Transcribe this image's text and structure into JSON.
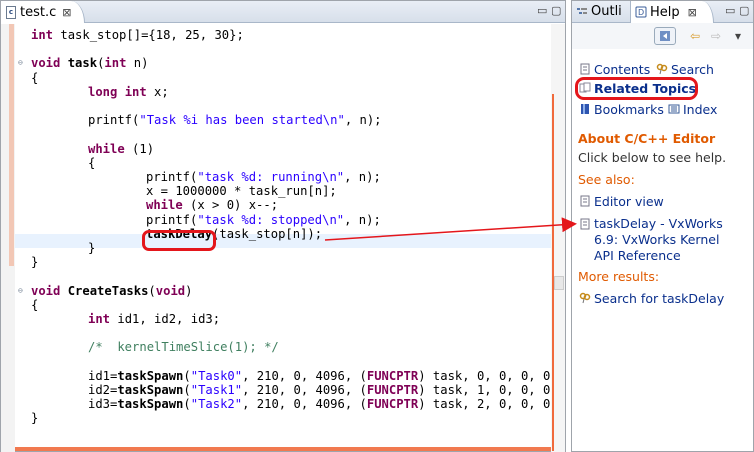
{
  "editor": {
    "tab_title": "test.c",
    "tab_close": "⊠",
    "minimize": "▭",
    "maximize": "▢",
    "lines": [
      [
        {
          "t": "int",
          "c": "kw"
        },
        {
          "t": " task_stop[]={18, 25, 30};"
        }
      ],
      [],
      [
        {
          "t": "void",
          "c": "kw"
        },
        {
          "t": " "
        },
        {
          "t": "task",
          "c": "fn"
        },
        {
          "t": "("
        },
        {
          "t": "int",
          "c": "kw"
        },
        {
          "t": " n)"
        }
      ],
      [
        {
          "t": "{"
        }
      ],
      [
        {
          "t": "long",
          "c": "kw"
        },
        {
          "t": " "
        },
        {
          "t": "int",
          "c": "kw"
        },
        {
          "t": " x;"
        }
      ],
      [],
      [
        {
          "t": "printf("
        },
        {
          "t": "\"Task %i has been started\\n\"",
          "c": "str"
        },
        {
          "t": ", n);"
        }
      ],
      [],
      [
        {
          "t": "while",
          "c": "kw"
        },
        {
          "t": " (1)"
        }
      ],
      [
        {
          "t": "{"
        }
      ],
      [
        {
          "t": "printf("
        },
        {
          "t": "\"task %d: running\\n\"",
          "c": "str"
        },
        {
          "t": ", n);"
        }
      ],
      [
        {
          "t": "x = 1000000 * task_run[n];"
        }
      ],
      [
        {
          "t": "while",
          "c": "kw"
        },
        {
          "t": " (x > 0) x--;"
        }
      ],
      [
        {
          "t": "printf("
        },
        {
          "t": "\"task %d: stopped\\n\"",
          "c": "str"
        },
        {
          "t": ", n);"
        }
      ],
      [
        {
          "t": "taskDelay",
          "c": "fn"
        },
        {
          "t": "(task_stop[n]);"
        }
      ],
      [
        {
          "t": "}"
        }
      ],
      [
        {
          "t": "}"
        }
      ],
      [],
      [
        {
          "t": "void",
          "c": "kw"
        },
        {
          "t": " "
        },
        {
          "t": "CreateTasks",
          "c": "fn"
        },
        {
          "t": "("
        },
        {
          "t": "void",
          "c": "kw"
        },
        {
          "t": ")"
        }
      ],
      [
        {
          "t": "{"
        }
      ],
      [
        {
          "t": "int",
          "c": "kw"
        },
        {
          "t": " id1, id2, id3;"
        }
      ],
      [],
      [
        {
          "t": "/*  kernelTimeSlice(1); */",
          "c": "cmt"
        }
      ],
      [],
      [
        {
          "t": "id1="
        },
        {
          "t": "taskSpawn",
          "c": "fn"
        },
        {
          "t": "("
        },
        {
          "t": "\"Task0\"",
          "c": "str"
        },
        {
          "t": ", 210, 0, 4096, ("
        },
        {
          "t": "FUNCPTR",
          "c": "kw"
        },
        {
          "t": ") task, 0, 0, 0, 0,"
        }
      ],
      [
        {
          "t": "id2="
        },
        {
          "t": "taskSpawn",
          "c": "fn"
        },
        {
          "t": "("
        },
        {
          "t": "\"Task1\"",
          "c": "str"
        },
        {
          "t": ", 210, 0, 4096, ("
        },
        {
          "t": "FUNCPTR",
          "c": "kw"
        },
        {
          "t": ") task, 1, 0, 0, 0,"
        }
      ],
      [
        {
          "t": "id3="
        },
        {
          "t": "taskSpawn",
          "c": "fn"
        },
        {
          "t": "("
        },
        {
          "t": "\"Task2\"",
          "c": "str"
        },
        {
          "t": ", 210, 0, 4096, ("
        },
        {
          "t": "FUNCPTR",
          "c": "kw"
        },
        {
          "t": ") task, 2, 0, 0, 0,"
        }
      ],
      [
        {
          "t": "}"
        }
      ]
    ]
  },
  "help": {
    "tab_outline": "Outli",
    "tab_help": "Help",
    "tab_close": "⊠",
    "minimize": "▭",
    "maximize": "▢",
    "toolbar": {
      "back": "⇦",
      "forward": "⇨",
      "menu": "▾"
    },
    "links": {
      "contents": "Contents",
      "search": "Search",
      "related_topics": "Related Topics",
      "bookmarks": "Bookmarks",
      "index": "Index"
    },
    "about_heading": "About C/C++ Editor",
    "about_text": "Click below to see help.",
    "see_also_heading": "See also:",
    "editor_view": "Editor view",
    "reference_line1": "taskDelay - VxWorks",
    "reference_line2": "6.9: VxWorks Kernel",
    "reference_line3": "API Reference",
    "more_results_heading": "More results:",
    "search_for": "Search for taskDelay"
  },
  "colors": {
    "keyword": "#7f0055",
    "string": "#2a00ff",
    "comment": "#3f7f5f",
    "link": "#0a2f8c",
    "heading": "#e05a00",
    "annotation": "#e4161b"
  }
}
